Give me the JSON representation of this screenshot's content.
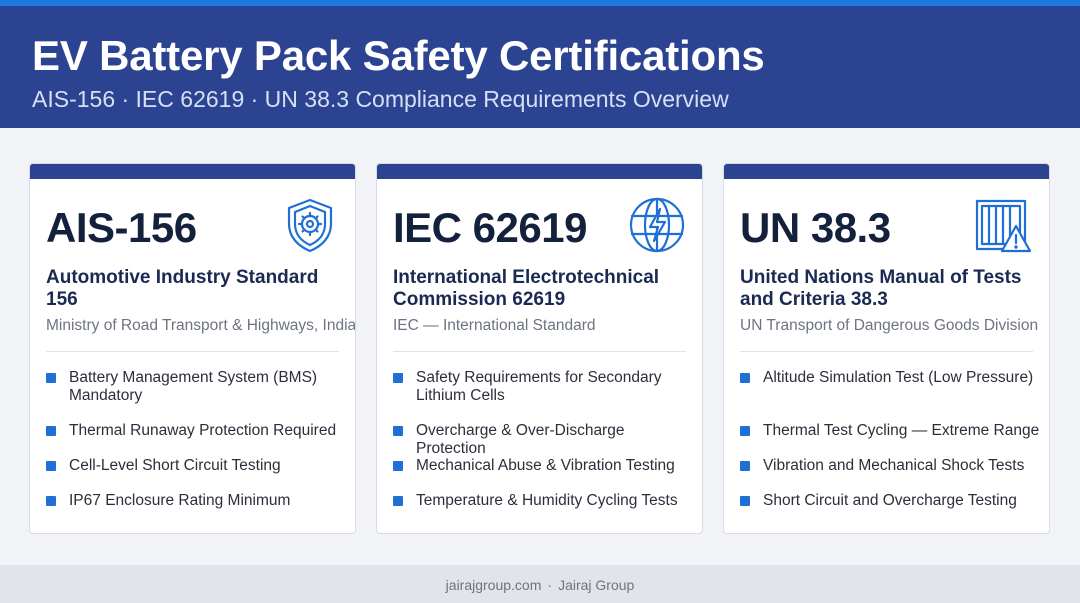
{
  "header": {
    "title": "EV Battery Pack Safety Certifications",
    "subtitle": "AIS-156 · IEC 62619 · UN 38.3 Compliance Requirements Overview"
  },
  "cards": [
    {
      "code": "AIS-156",
      "name": "Automotive Industry Standard 156",
      "org": "Ministry of Road Transport & Highways, India",
      "icon": "shield-gear-icon",
      "items": [
        "Battery Management System (BMS) Mandatory",
        "Thermal Runaway Protection Required",
        "Cell-Level Short Circuit Testing",
        "IP67 Enclosure Rating Minimum"
      ]
    },
    {
      "code": "IEC 62619",
      "name": "International Electrotechnical Commission 62619",
      "org": "IEC — International Standard",
      "icon": "globe-lightning-icon",
      "items": [
        "Safety Requirements for Secondary Lithium Cells",
        "Overcharge & Over-Discharge Protection",
        "Mechanical Abuse & Vibration Testing",
        "Temperature & Humidity Cycling Tests"
      ]
    },
    {
      "code": "UN 38.3",
      "name": "United Nations Manual of Tests and Criteria 38.3",
      "org": "UN Transport of Dangerous Goods Division",
      "icon": "crate-warning-icon",
      "items": [
        "Altitude Simulation Test (Low Pressure)",
        "Thermal Test Cycling — Extreme Range",
        "Vibration and Mechanical Shock Tests",
        "Short Circuit and Overcharge Testing"
      ]
    }
  ],
  "footer": {
    "site": "jairajgroup.com",
    "separator": "·",
    "brand": "Jairaj Group"
  },
  "colors": {
    "header_bg": "#2b4391",
    "accent_stripe": "#1f7ae0",
    "bullet": "#1f6fd6",
    "icon": "#1f6fd6"
  }
}
